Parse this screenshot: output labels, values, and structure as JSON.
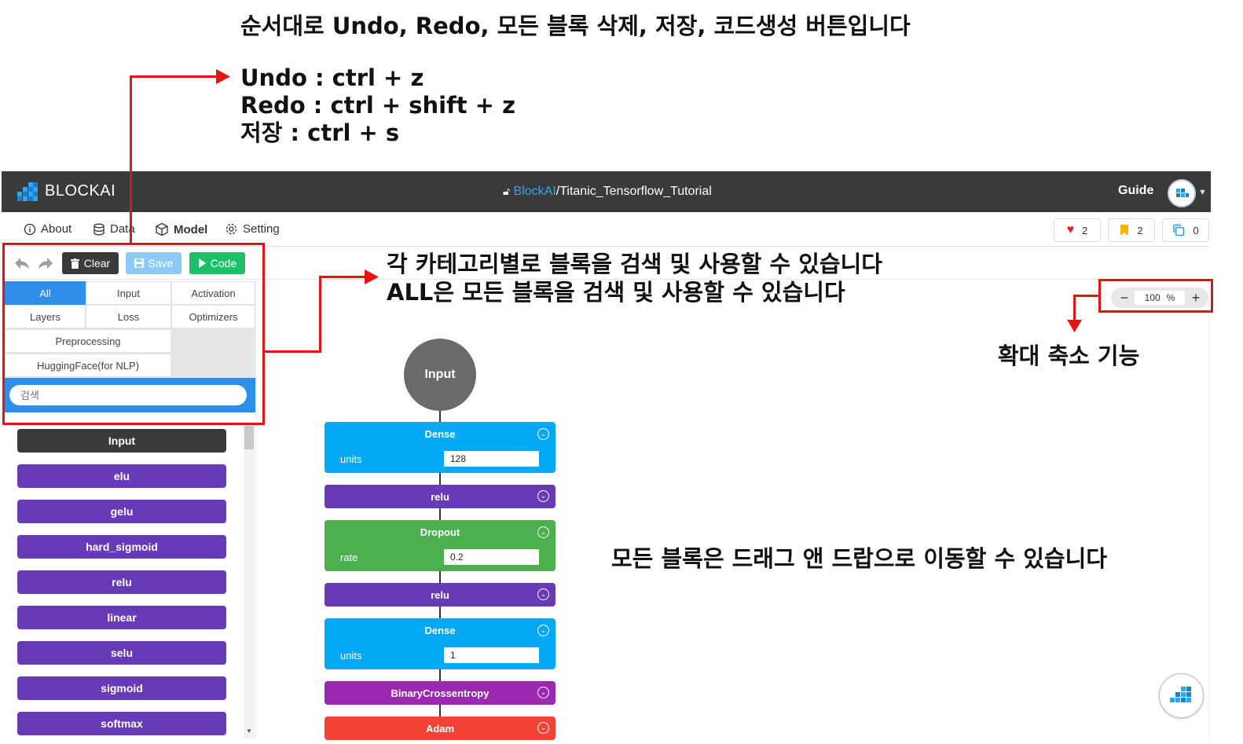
{
  "annotations": {
    "buttons_order": "순서대로 Undo, Redo, 모든 블록 삭제, 저장, 코드생성 버튼입니다",
    "shortcut_undo": "Undo : ctrl  +  z",
    "shortcut_redo": "Redo : ctrl  +  shift  +  z",
    "shortcut_save": "저장 : ctrl  +  s",
    "category_line1": "각 카테고리별로 블록을 검색 및 사용할 수 있습니다",
    "category_line2": "ALL은 모든 블록을 검색 및 사용할 수 있습니다",
    "zoom_feature": "확대 축소 기능",
    "drag_drop": "모든 블록은 드래그 앤 드랍으로 이동할 수 있습니다"
  },
  "header": {
    "brand": "BLOCKAI",
    "project_org": "BlockAI",
    "project_name": "/Titanic_Tensorflow_Tutorial",
    "guide_label": "Guide"
  },
  "menu": {
    "about": "About",
    "data": "Data",
    "model": "Model",
    "setting": "Setting",
    "likes": "2",
    "bookmarks": "2",
    "copies": "0"
  },
  "toolbar": {
    "clear_label": "Clear",
    "save_label": "Save",
    "code_label": "Code"
  },
  "categories": {
    "all": "All",
    "input": "Input",
    "activation": "Activation",
    "layers": "Layers",
    "loss": "Loss",
    "optimizers": "Optimizers",
    "preprocessing": "Preprocessing",
    "huggingface": "HuggingFace(for NLP)"
  },
  "search": {
    "placeholder": "검색"
  },
  "palette": [
    "Input",
    "elu",
    "gelu",
    "hard_sigmoid",
    "relu",
    "linear",
    "selu",
    "sigmoid",
    "softmax"
  ],
  "canvas": {
    "input_node": "Input",
    "dense1_title": "Dense",
    "dense1_param": "units",
    "dense1_value": "128",
    "relu1": "relu",
    "dropout_title": "Dropout",
    "dropout_param": "rate",
    "dropout_value": "0.2",
    "relu2": "relu",
    "dense2_title": "Dense",
    "dense2_param": "units",
    "dense2_value": "1",
    "loss": "BinaryCrossentropy",
    "optimizer": "Adam"
  },
  "zoom": {
    "value": "100",
    "unit": "%",
    "minus": "−",
    "plus": "+"
  },
  "colors": {
    "header_bg": "#3a3a3a",
    "accent_blue": "#2d8fe9",
    "activation_purple": "#673ab7",
    "layer_blue": "#03a9f4",
    "dropout_green": "#4caf50",
    "loss_purple": "#9c27b0",
    "optimizer_red": "#f44336",
    "annotation_red": "#e81212"
  }
}
